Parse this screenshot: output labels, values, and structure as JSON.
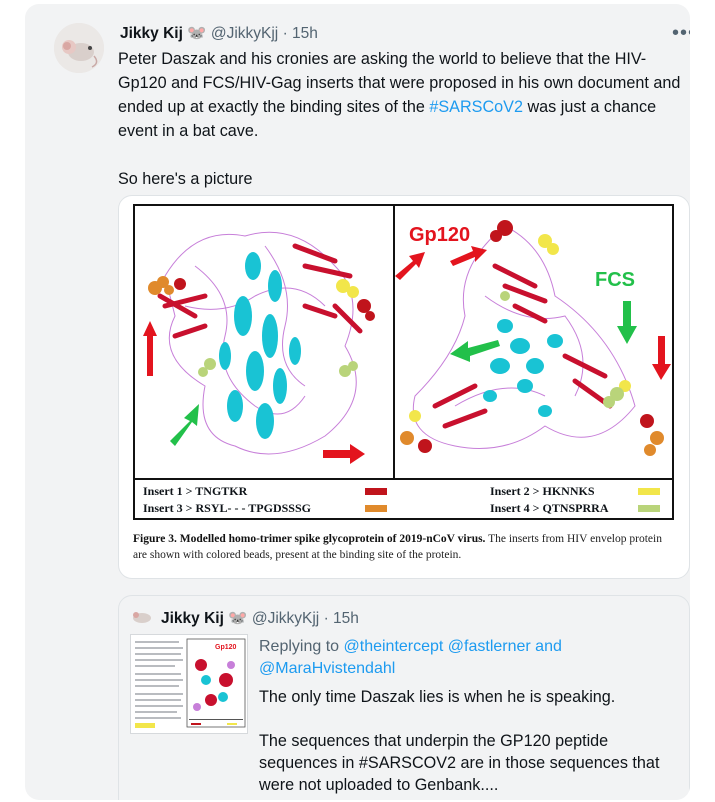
{
  "tweet": {
    "author_name": "Jikky Kij",
    "author_emoji": "🐭",
    "handle": "@JikkyKjj",
    "separator": "·",
    "time": "15h",
    "more_icon": "more-horizontal-icon",
    "text_part1": "Peter Daszak and his cronies are asking the world to believe that the HIV-Gp120 and FCS/HIV-Gag inserts that were proposed in his own document and ended up at exactly the binding sites of the ",
    "hashtag": "#SARSCoV2",
    "text_part2": " was just a chance event in a bat cave.",
    "text_line2": "So here's a picture"
  },
  "figure": {
    "label_gp120": "Gp120",
    "label_fcs": "FCS",
    "legend": [
      {
        "label": "Insert 1 > TNGTKR",
        "color": "#c0141c"
      },
      {
        "label": "Insert  3 >  RSYL- - - TPGDSSSG",
        "color": "#e08a2c"
      },
      {
        "label": "Insert 2 >  HKNNKS",
        "color": "#f2e64a"
      },
      {
        "label": "Insert 4 > QTNSPRRA",
        "color": "#b9d47a"
      }
    ],
    "caption_bold": "Figure 3. Modelled homo-trimer spike glycoprotein of 2019-nCoV virus.",
    "caption_rest": " The inserts from HIV envelop protein are shown with colored beads, present at the binding site of the protein.",
    "colors": {
      "strand": "#c8102e",
      "helix": "#19c3d4",
      "coil": "#c77fd9",
      "arrow_red": "#e3141e",
      "arrow_green": "#22c04a"
    }
  },
  "quote": {
    "author_name": "Jikky Kij",
    "author_emoji": "🐭",
    "handle": "@JikkyKjj",
    "separator": "·",
    "time": "15h",
    "replying_prefix": "Replying to ",
    "replying_handles": "@theintercept @fastlerner and @MaraHvistendahl",
    "text1": "The only time Daszak lies is when he is speaking.",
    "text2": "The sequences that underpin the GP120 peptide sequences in #SARSCOV2 are in those sequences that were not uploaded to Genbank...."
  }
}
